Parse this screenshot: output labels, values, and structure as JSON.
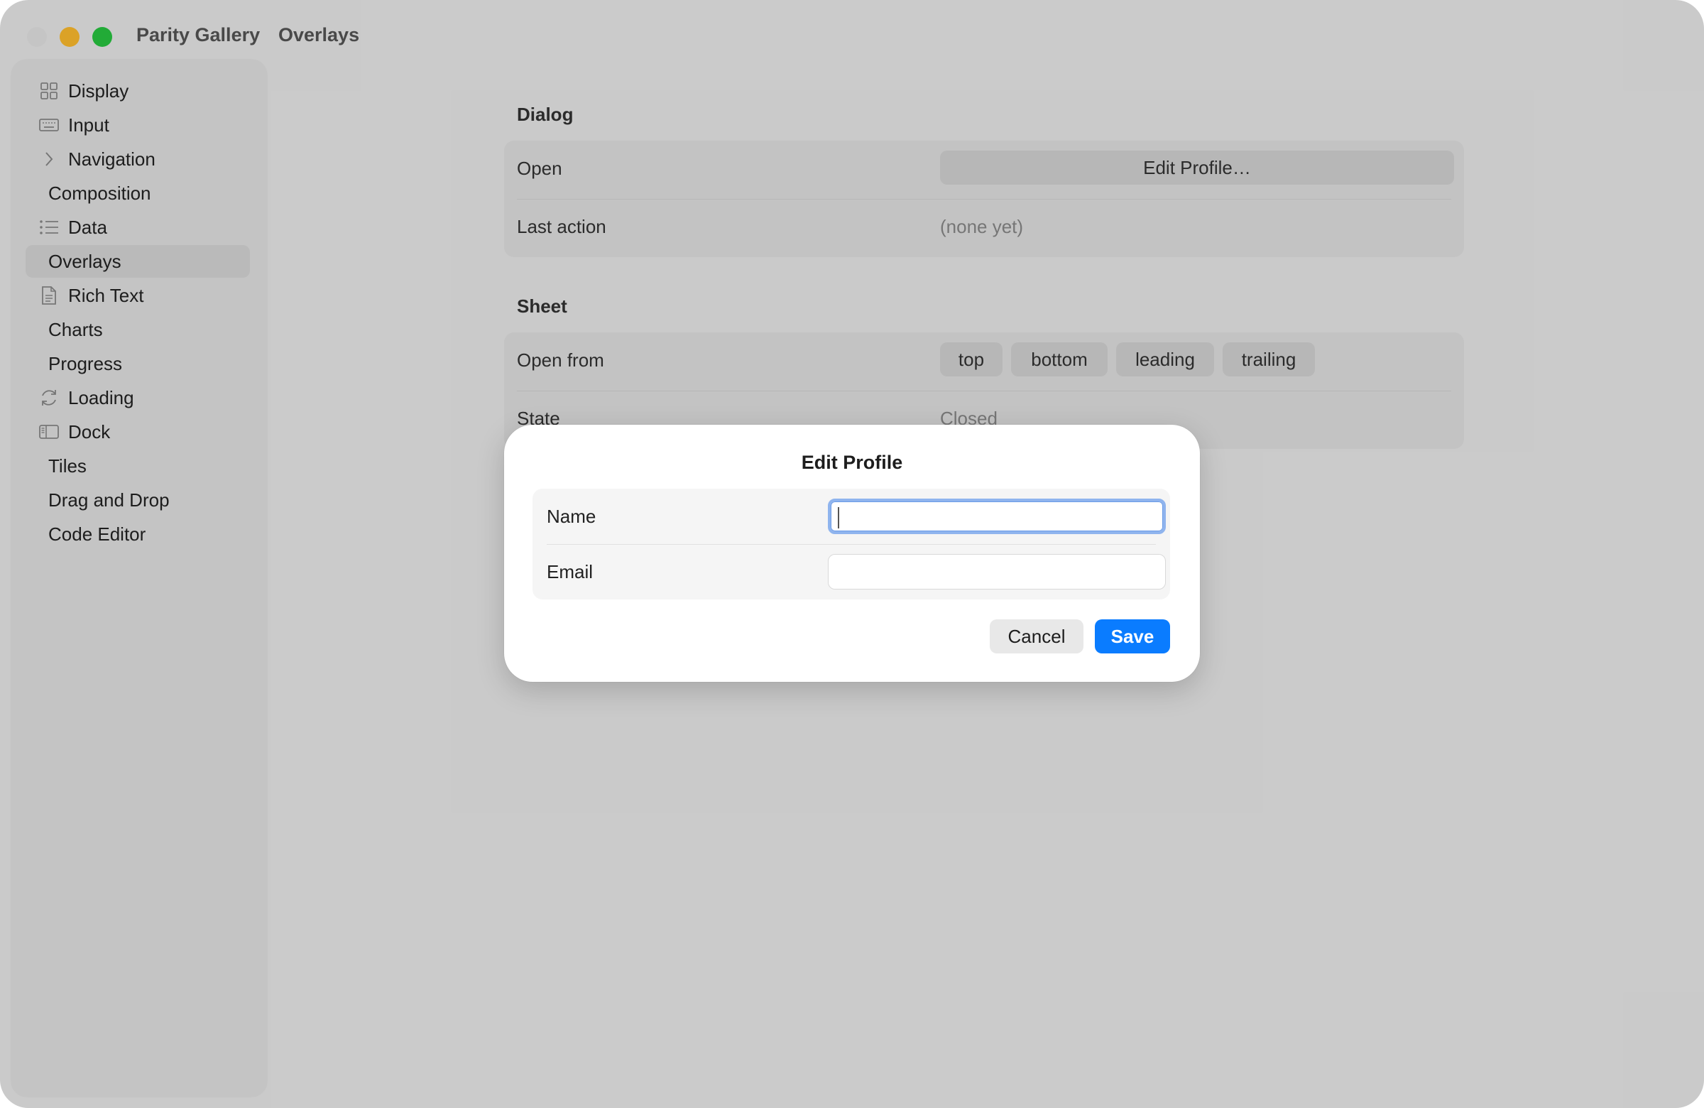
{
  "app": {
    "title": "Parity Gallery",
    "section": "Overlays"
  },
  "sidebar": {
    "items": [
      {
        "label": "Display",
        "icon": "grid-icon"
      },
      {
        "label": "Input",
        "icon": "keyboard-icon"
      },
      {
        "label": "Navigation",
        "icon": "chevron-right-icon"
      },
      {
        "label": "Composition",
        "icon": ""
      },
      {
        "label": "Data",
        "icon": "list-icon"
      },
      {
        "label": "Overlays",
        "icon": "",
        "active": true
      },
      {
        "label": "Rich Text",
        "icon": "document-icon"
      },
      {
        "label": "Charts",
        "icon": ""
      },
      {
        "label": "Progress",
        "icon": ""
      },
      {
        "label": "Loading",
        "icon": "refresh-icon"
      },
      {
        "label": "Dock",
        "icon": "sidebar-panel-icon"
      },
      {
        "label": "Tiles",
        "icon": ""
      },
      {
        "label": "Drag and Drop",
        "icon": ""
      },
      {
        "label": "Code Editor",
        "icon": ""
      }
    ]
  },
  "dialog_section": {
    "title": "Dialog",
    "open_label": "Open",
    "open_button": "Edit Profile…",
    "last_action_label": "Last action",
    "last_action_value": "(none yet)"
  },
  "sheet_section": {
    "title": "Sheet",
    "open_from_label": "Open from",
    "options": [
      "top",
      "bottom",
      "leading",
      "trailing"
    ],
    "state_label": "State",
    "state_value": "Closed"
  },
  "modal": {
    "title": "Edit Profile",
    "name_label": "Name",
    "name_value": "",
    "email_label": "Email",
    "email_value": "",
    "cancel_label": "Cancel",
    "save_label": "Save"
  },
  "colors": {
    "accent": "#0a7cff",
    "focus_ring": "#8fb4ee",
    "traffic_close": "#e6e6e6",
    "traffic_minimize": "#ffbd2e",
    "traffic_maximize": "#28c840"
  }
}
